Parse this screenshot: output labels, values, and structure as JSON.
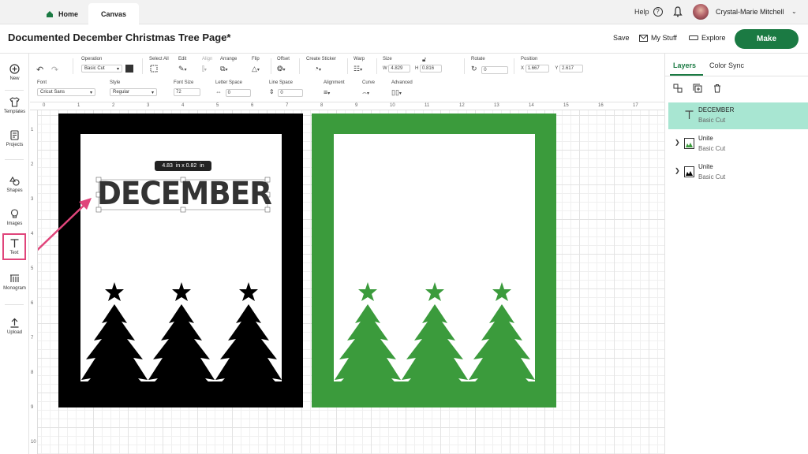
{
  "tabs": {
    "home": "Home",
    "canvas": "Canvas"
  },
  "header": {
    "help": "Help",
    "user": "Crystal-Marie Mitchell"
  },
  "document": {
    "title": "Documented December Christmas Tree Page*"
  },
  "actions": {
    "save": "Save",
    "my_stuff": "My Stuff",
    "explore": "Explore",
    "make": "Make"
  },
  "sidebar": {
    "items": [
      {
        "label": "New",
        "icon": "plus-circle-icon"
      },
      {
        "label": "Templates",
        "icon": "shirt-icon"
      },
      {
        "label": "Projects",
        "icon": "projects-icon"
      },
      {
        "label": "Shapes",
        "icon": "shapes-icon"
      },
      {
        "label": "Images",
        "icon": "bulb-icon"
      },
      {
        "label": "Text",
        "icon": "text-icon"
      },
      {
        "label": "Monogram",
        "icon": "monogram-icon"
      },
      {
        "label": "Upload",
        "icon": "upload-icon"
      }
    ]
  },
  "toolbar": {
    "operation_label": "Operation",
    "operation_value": "Basic Cut",
    "select_all": "Select All",
    "edit": "Edit",
    "align": "Align",
    "arrange": "Arrange",
    "flip": "Flip",
    "offset": "Offset",
    "create_sticker": "Create Sticker",
    "warp": "Warp",
    "size": "Size",
    "w_label": "W",
    "w_value": "4.829",
    "h_label": "H",
    "h_value": "0.816",
    "rotate": "Rotate",
    "rotate_value": "0",
    "position": "Position",
    "x_label": "X",
    "x_value": "1.667",
    "y_label": "Y",
    "y_value": "2.617",
    "font_label": "Font",
    "font_value": "Cricut Sans",
    "style_label": "Style",
    "style_value": "Regular",
    "font_size_label": "Font Size",
    "font_size_value": "72",
    "letter_space_label": "Letter Space",
    "letter_space_value": "0",
    "line_space_label": "Line Space",
    "line_space_value": "0",
    "alignment_label": "Alignment",
    "curve_label": "Curve",
    "advanced_label": "Advanced",
    "operation_color": "#333333"
  },
  "ruler": {
    "h": [
      "0",
      "1",
      "2",
      "3",
      "4",
      "5",
      "6",
      "7",
      "8",
      "9",
      "10",
      "11",
      "12",
      "13",
      "14",
      "15",
      "16",
      "17"
    ],
    "v": [
      "1",
      "2",
      "3",
      "4",
      "5",
      "6",
      "7",
      "8",
      "9",
      "10"
    ]
  },
  "canvas": {
    "text": "DECEMBER",
    "dimension_tooltip": "4.83  in x 0.82  in",
    "colors": {
      "black_panel": "#000000",
      "green_panel": "#3b9b3c",
      "annotation": "#e0457b"
    }
  },
  "layers_panel": {
    "tab_layers": "Layers",
    "tab_color_sync": "Color Sync",
    "layers": [
      {
        "name": "DECEMBER",
        "sub": "Basic Cut",
        "icon": "text-icon"
      },
      {
        "name": "Unite",
        "sub": "Basic Cut",
        "icon": "image-icon"
      },
      {
        "name": "Unite",
        "sub": "Basic Cut",
        "icon": "image-icon"
      }
    ]
  }
}
